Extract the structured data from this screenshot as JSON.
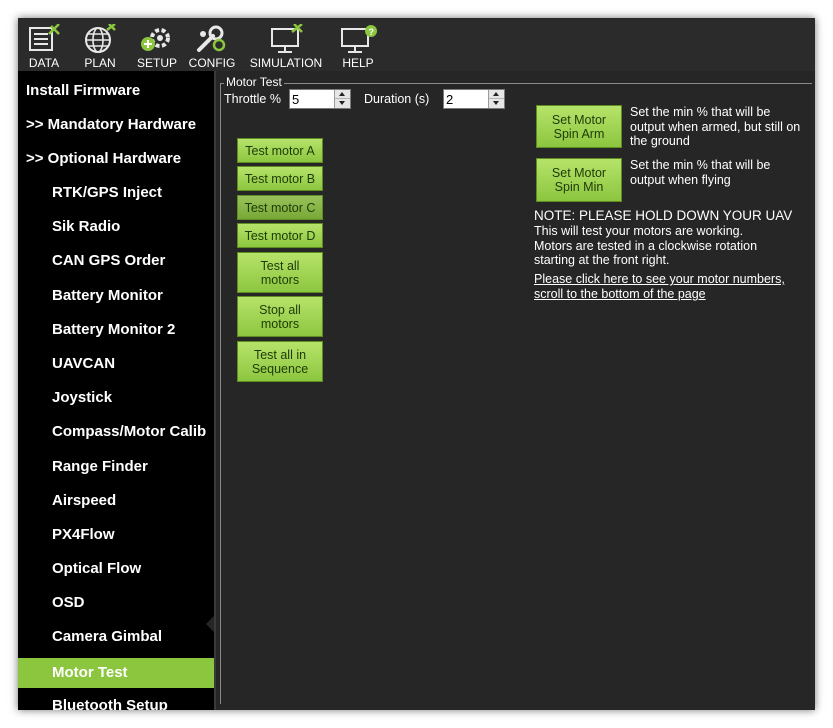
{
  "toolbar": {
    "data": "DATA",
    "plan": "PLAN",
    "setup": "SETUP",
    "config": "CONFIG",
    "simulation": "SIMULATION",
    "help": "HELP"
  },
  "sidebar": {
    "items": [
      {
        "label": "Install Firmware"
      },
      {
        "label": ">> Mandatory Hardware"
      },
      {
        "label": ">> Optional Hardware"
      },
      {
        "label": "RTK/GPS Inject"
      },
      {
        "label": "Sik Radio"
      },
      {
        "label": "CAN GPS Order"
      },
      {
        "label": "Battery Monitor"
      },
      {
        "label": "Battery Monitor 2"
      },
      {
        "label": "UAVCAN"
      },
      {
        "label": "Joystick"
      },
      {
        "label": "Compass/Motor Calib"
      },
      {
        "label": "Range Finder"
      },
      {
        "label": "Airspeed"
      },
      {
        "label": "PX4Flow"
      },
      {
        "label": "Optical Flow"
      },
      {
        "label": "OSD"
      },
      {
        "label": "Camera Gimbal"
      },
      {
        "label": "Motor Test"
      },
      {
        "label": "Bluetooth Setup"
      }
    ],
    "active": "Motor Test"
  },
  "motor_test": {
    "group_title": "Motor Test",
    "throttle_label": "Throttle %",
    "throttle_value": "5",
    "duration_label": "Duration (s)",
    "duration_value": "2",
    "buttons": {
      "test_a": "Test motor A",
      "test_b": "Test motor B",
      "test_c": "Test motor C",
      "test_d": "Test motor D",
      "test_all_line1": "Test all",
      "test_all_line2": "motors",
      "stop_all_line1": "Stop all",
      "stop_all_line2": "motors",
      "seq_line1": "Test all in",
      "seq_line2": "Sequence",
      "spin_arm_line1": "Set Motor",
      "spin_arm_line2": "Spin Arm",
      "spin_min_line1": "Set Motor",
      "spin_min_line2": "Spin Min"
    },
    "spin_arm_desc": {
      "line1": "Set the min % that will be",
      "line2": "output when armed, but still on",
      "line3": "the ground"
    },
    "spin_min_desc": {
      "line1": "Set the min % that will be",
      "line2": "output when flying"
    },
    "note": {
      "line1": "NOTE: PLEASE HOLD DOWN YOUR UAV",
      "line2": "This will test your motors are working.",
      "line3": "Motors are tested in a clockwise rotation",
      "line4": "starting at the front right."
    },
    "link": {
      "line1": "Please click here to see your motor numbers,",
      "line2": "scroll to the bottom of the page"
    }
  },
  "colors": {
    "accent_green": "#8cc63f",
    "panel_bg": "#262626",
    "sidebar_bg": "#000000"
  }
}
